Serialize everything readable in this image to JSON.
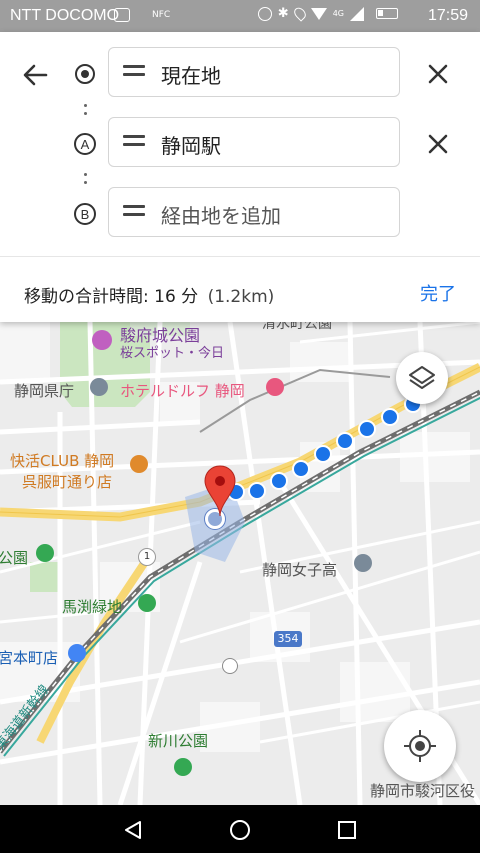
{
  "status_bar": {
    "carrier": "NTT DOCOMO",
    "nfc": "NFC",
    "network": "4G",
    "time": "17:59"
  },
  "route": {
    "origin": "現在地",
    "destination": "静岡駅",
    "waypoint_placeholder": "経由地を追加",
    "marker_a": "A",
    "marker_b": "B"
  },
  "summary": {
    "label": "移動の合計時間: 16 分",
    "distance": "(1.2km)",
    "done_label": "完了"
  },
  "map": {
    "labels": {
      "park_sunpu": "駿府城公園",
      "park_sunpu_sub": "桜スポット・今日",
      "prefecture": "静岡県庁",
      "hotel": "ホテルドルフ 静岡",
      "club_1": "快活CLUB 静岡",
      "club_2": "呉服町通り店",
      "highschool": "静岡女子高",
      "mabuchi": "馬渕緑地",
      "miyamoto": "宮本町店",
      "shinkawa": "新川公園",
      "ward": "静岡市駿河区役",
      "shinkansen": "東海道新幹線",
      "park_left": "公園",
      "road_1": "1",
      "road_354": "354",
      "top_cut": "清水町公園"
    },
    "colors": {
      "route_dot": "#1a73e8",
      "pin": "#ea4335",
      "park_green": "#34a853",
      "poi_pink": "#e8577e",
      "poi_orange": "#e08a2c",
      "poi_blue": "#4285f4"
    }
  }
}
